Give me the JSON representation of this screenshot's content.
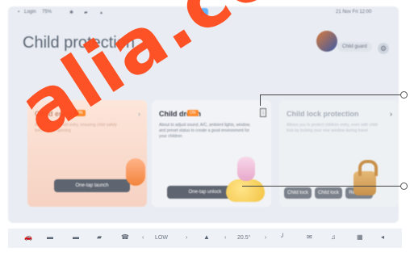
{
  "status_bar": {
    "signal": "Login",
    "battery": "75%",
    "right_time": "21 Nov Fri 12:00"
  },
  "page_title": "Child protection",
  "header": {
    "child_guard_label": "Child guard"
  },
  "cards": [
    {
      "title": "Child entry",
      "badge": "ON",
      "desc": "About to start child entry, ensuring child safety before door opening",
      "button": "One-tap launch"
    },
    {
      "title": "Child dream",
      "badge": "ON",
      "desc": "About to adjust sound, A/C, ambient lights, window, and preset status to create a good environment for your children",
      "button": "One-tap unlock"
    },
    {
      "title": "Child lock protection",
      "desc": "Allows you to protect children entry, even with child lock by locking your rear window during travel",
      "buttons": [
        "Child lock",
        "Child lock",
        "Rear lock"
      ]
    }
  ],
  "dock": {
    "left_temp": "LOW",
    "right_temp": "20.5°"
  },
  "watermark": "alia.co",
  "colors": {
    "accent": "#ff8a2a",
    "watermark": "#ff4a1c"
  }
}
